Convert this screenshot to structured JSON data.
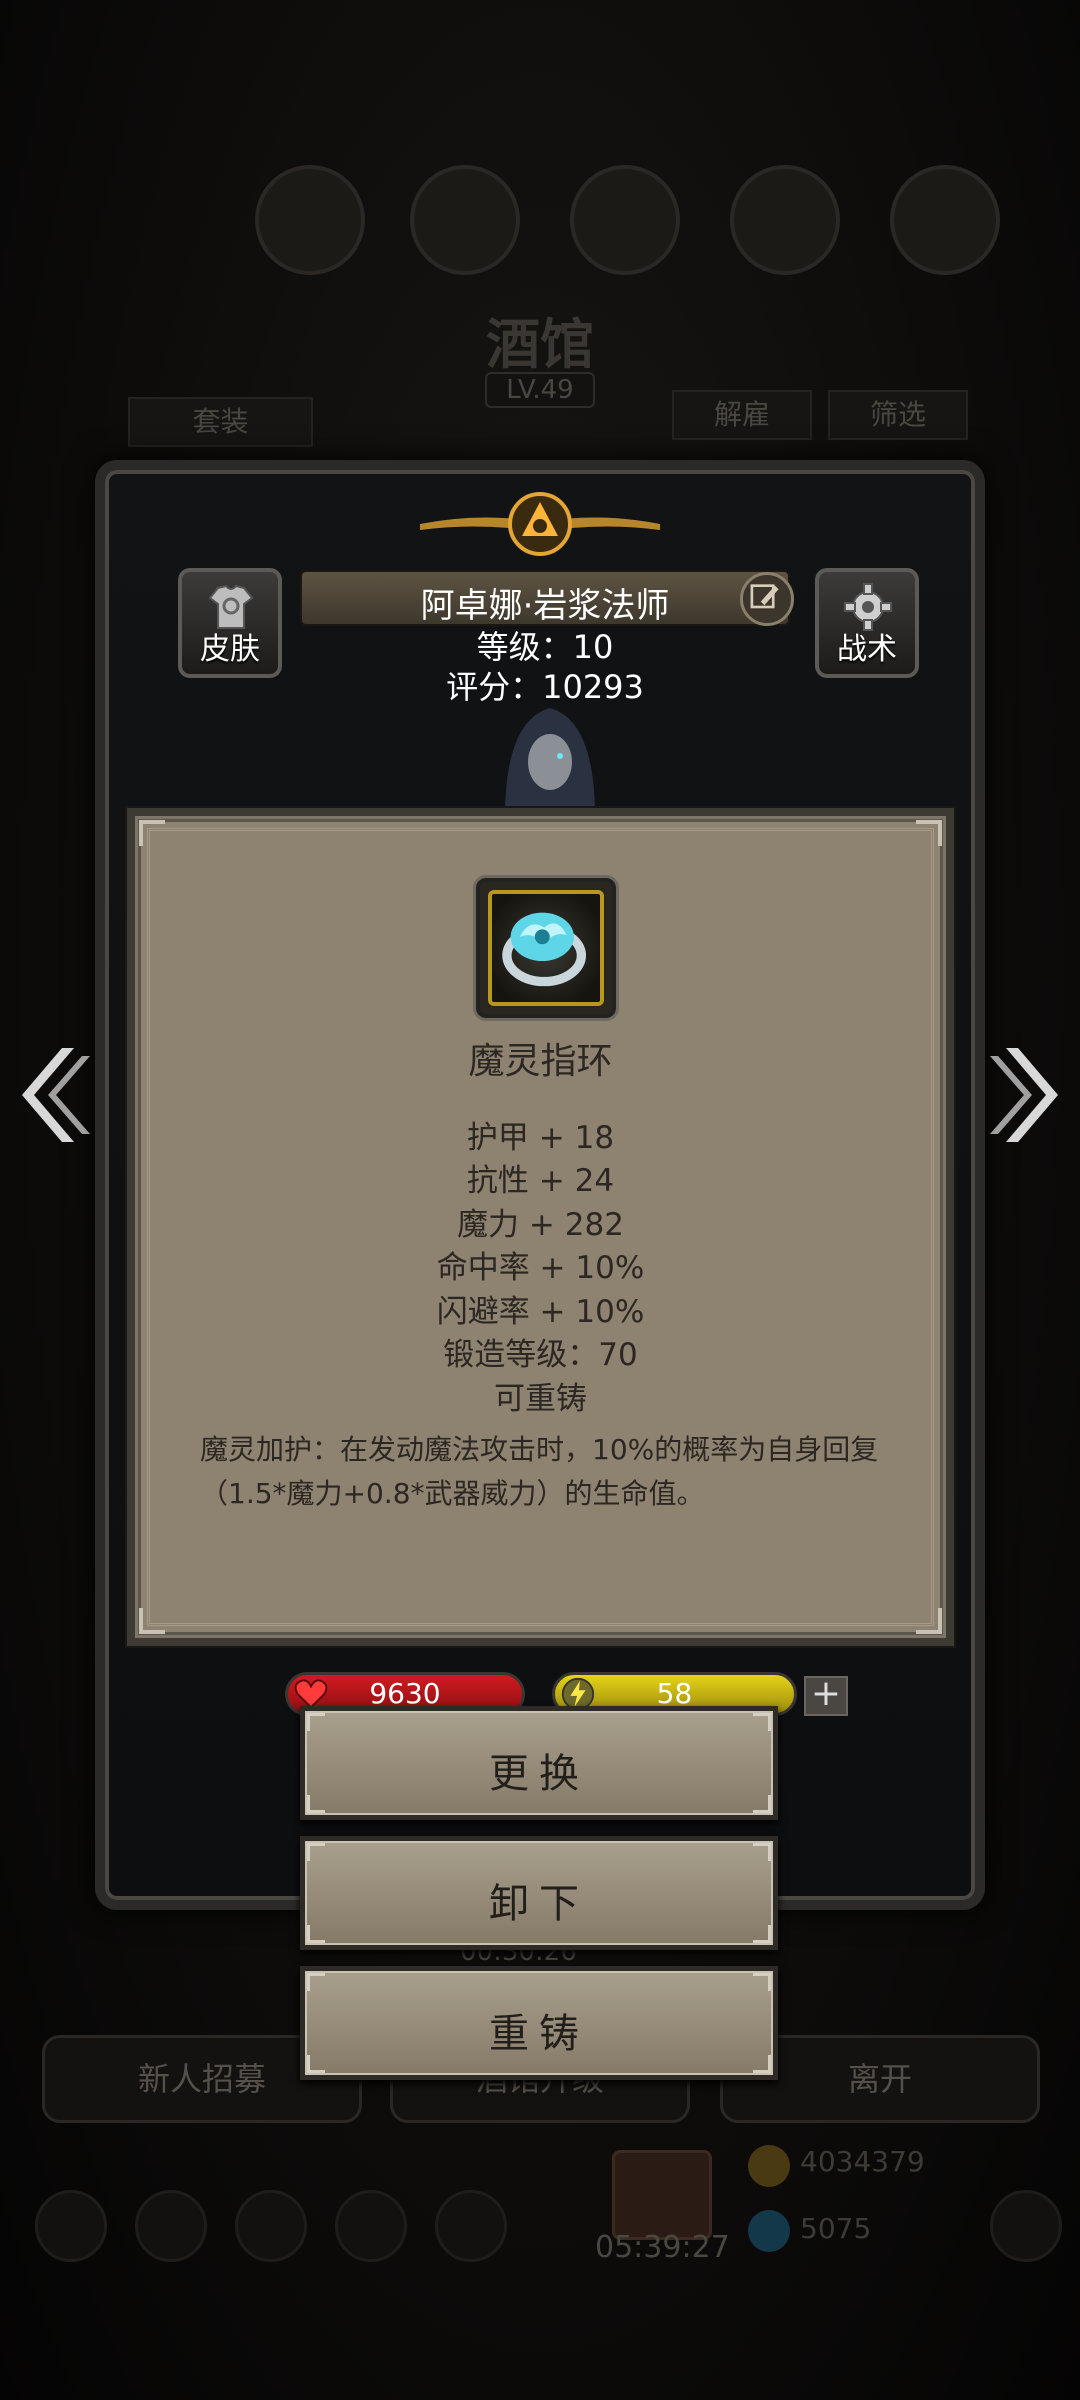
{
  "background": {
    "title": "酒馆",
    "level": "LV.49",
    "suit_button": "套装",
    "dismiss_button": "解雇",
    "filter_button": "筛选",
    "recruit_button": "新人招募",
    "upgrade_button": "酒馆升级",
    "leave_button": "离开",
    "gold": "4034379",
    "gems": "5075",
    "timer": "00:30:26",
    "clock": "05:39:27"
  },
  "hero": {
    "skin_label": "皮肤",
    "tactics_label": "战术",
    "name": "阿卓娜·岩浆法师",
    "level_line": "等级：10",
    "score_line": "评分：10293",
    "hp_value": "9630",
    "energy_value": "58"
  },
  "item": {
    "name": "魔灵指环",
    "stats": [
      "护甲 + 18",
      "抗性 + 24",
      "魔力 + 282",
      "命中率 + 10%",
      "闪避率 + 10%",
      "锻造等级：70",
      "可重铸"
    ],
    "description": "魔灵加护：在发动魔法攻击时，10%的概率为自身回复（1.5*魔力+0.8*武器威力）的生命值。"
  },
  "actions": {
    "replace": "更换",
    "unequip": "卸下",
    "reforge": "重铸"
  },
  "colors": {
    "card_bg": "#8e8270",
    "text_dark": "#2c2722",
    "hp_red": "#b3151a",
    "energy_yellow": "#c8b414",
    "ring_cyan": "#5fd6e8"
  }
}
